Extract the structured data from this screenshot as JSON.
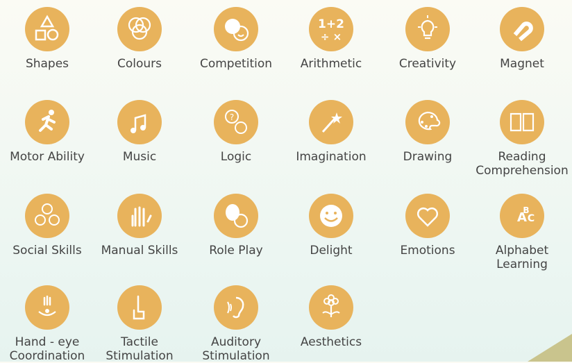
{
  "colors": {
    "icon_bg": "#e8b35c",
    "text": "#444444"
  },
  "skills": [
    {
      "label": "Shapes",
      "icon": "shapes-icon"
    },
    {
      "label": "Colours",
      "icon": "colours-icon"
    },
    {
      "label": "Competition",
      "icon": "competition-icon"
    },
    {
      "label": "Arithmetic",
      "icon": "arithmetic-icon"
    },
    {
      "label": "Creativity",
      "icon": "lightbulb-icon"
    },
    {
      "label": "Magnet",
      "icon": "magnet-icon"
    },
    {
      "label": "Motor Ability",
      "icon": "running-person-icon"
    },
    {
      "label": "Music",
      "icon": "music-note-icon"
    },
    {
      "label": "Logic",
      "icon": "logic-icon"
    },
    {
      "label": "Imagination",
      "icon": "magic-wand-icon"
    },
    {
      "label": "Drawing",
      "icon": "palette-icon"
    },
    {
      "label": "Reading Comprehension",
      "icon": "book-icon"
    },
    {
      "label": "Social Skills",
      "icon": "social-faces-icon"
    },
    {
      "label": "Manual Skills",
      "icon": "hand-icon"
    },
    {
      "label": "Role Play",
      "icon": "masks-icon"
    },
    {
      "label": "Delight",
      "icon": "smiley-icon"
    },
    {
      "label": "Emotions",
      "icon": "heart-icon"
    },
    {
      "label": "Alphabet Learning",
      "icon": "abc-icon"
    },
    {
      "label": "Hand - eye Coordination",
      "icon": "hand-eye-icon"
    },
    {
      "label": "Tactile Stimulation",
      "icon": "pointing-finger-icon"
    },
    {
      "label": "Auditory Stimulation",
      "icon": "ear-icon"
    },
    {
      "label": "Aesthetics",
      "icon": "flower-icon"
    }
  ]
}
